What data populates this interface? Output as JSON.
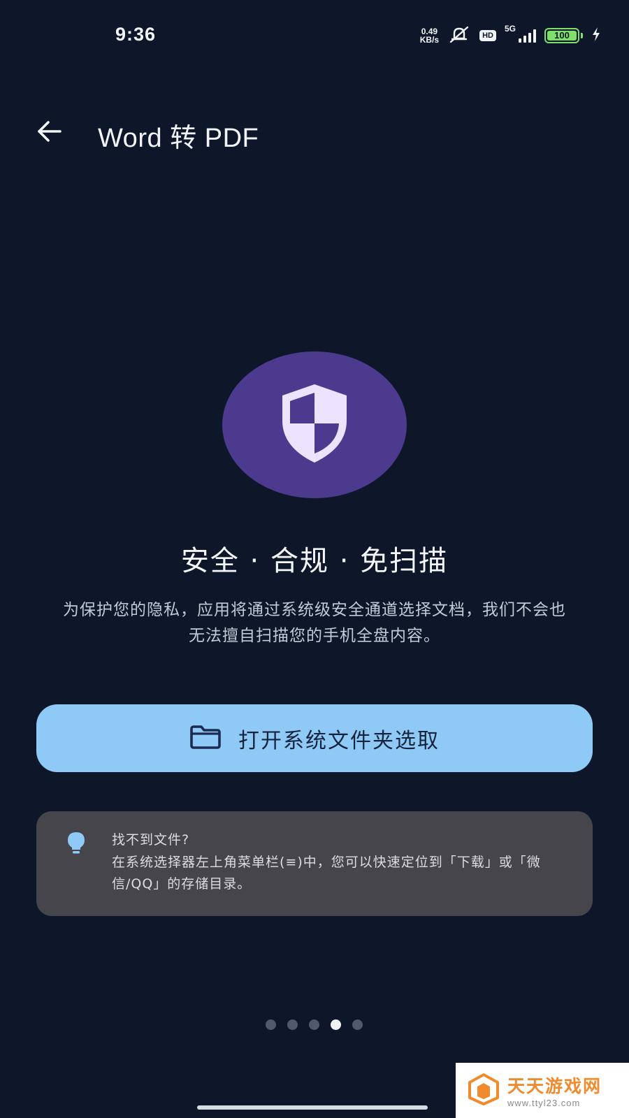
{
  "status_bar": {
    "time": "9:36",
    "net_speed_value": "0.49",
    "net_speed_unit": "KB/s",
    "hd_badge": "HD",
    "network_type": "5G",
    "battery_level": "100",
    "icons": [
      "mute-icon",
      "signal-icon",
      "battery-icon",
      "charging-icon"
    ]
  },
  "app_bar": {
    "title": "Word 转 PDF",
    "back_icon": "arrow-left-icon"
  },
  "hero": {
    "icon": "shield-icon",
    "circle_color": "#4b3a8e",
    "headline": "安全 · 合规 · 免扫描",
    "description": "为保护您的隐私，应用将通过系统级安全通道选择文档，我们不会也无法擅自扫描您的手机全盘内容。"
  },
  "open_button": {
    "icon": "folder-icon",
    "label": "打开系统文件夹选取",
    "color": "#8fcaf7"
  },
  "tip": {
    "icon": "lightbulb-icon",
    "title": "找不到文件?",
    "body": "在系统选择器左上角菜单栏(≡)中，您可以快速定位到「下载」或「微信/QQ」的存储目录。"
  },
  "pager": {
    "count": 5,
    "active_index": 3
  },
  "watermark": {
    "title": "天天游戏网",
    "url": "www.ttyl23.com"
  }
}
